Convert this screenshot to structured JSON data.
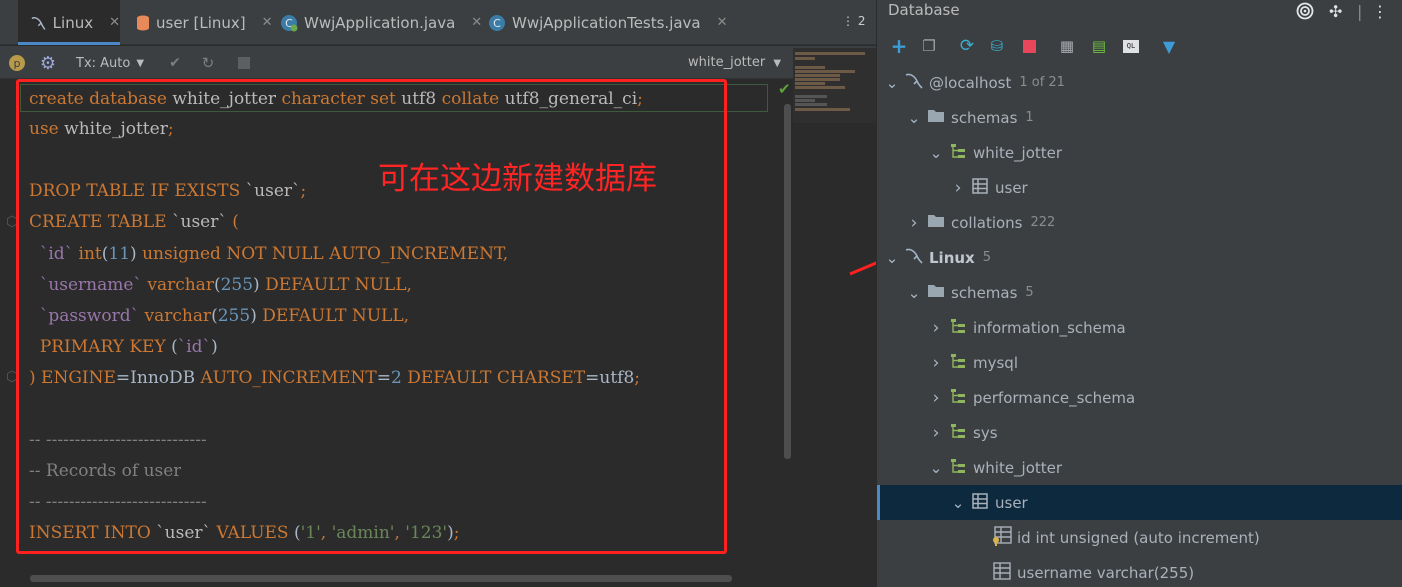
{
  "tabs": [
    {
      "label": "Linux",
      "icon": "mysql-dolphin-icon",
      "active": true
    },
    {
      "label": "user [Linux]",
      "icon": "table-icon",
      "active": false
    },
    {
      "label": "WwjApplication.java",
      "icon": "spring-class-icon",
      "active": false
    },
    {
      "label": "WwjApplicationTests.java",
      "icon": "class-icon",
      "active": false
    }
  ],
  "tab_overflow_count": "2",
  "toolbar": {
    "tx_mode": "Tx: Auto",
    "schema": "white_jotter"
  },
  "code_lines": [
    [
      [
        "kw",
        "create database "
      ],
      [
        "id",
        "white_jotter "
      ],
      [
        "kw",
        "character set "
      ],
      [
        "id",
        "utf8 "
      ],
      [
        "kw",
        "collate "
      ],
      [
        "id",
        "utf8_general_ci"
      ],
      [
        "kw",
        ";"
      ]
    ],
    [
      [
        "kw",
        "use "
      ],
      [
        "id",
        "white_jotter"
      ],
      [
        "kw",
        ";"
      ]
    ],
    [],
    [
      [
        "kw",
        "DROP TABLE IF EXISTS "
      ],
      [
        "id",
        "`user`"
      ],
      [
        "kw",
        ";"
      ]
    ],
    [
      [
        "kw",
        "CREATE TABLE "
      ],
      [
        "id",
        "`user` "
      ],
      [
        "kw",
        "("
      ]
    ],
    [
      [
        "pl",
        "  "
      ],
      [
        "bq",
        "`id` "
      ],
      [
        "kw",
        "int"
      ],
      [
        "pl",
        "("
      ],
      [
        "num",
        "11"
      ],
      [
        "pl",
        ") "
      ],
      [
        "kw",
        "unsigned NOT NULL AUTO_INCREMENT,"
      ]
    ],
    [
      [
        "pl",
        "  "
      ],
      [
        "bq",
        "`username` "
      ],
      [
        "kw",
        "varchar"
      ],
      [
        "pl",
        "("
      ],
      [
        "num",
        "255"
      ],
      [
        "pl",
        ") "
      ],
      [
        "kw",
        "DEFAULT NULL,"
      ]
    ],
    [
      [
        "pl",
        "  "
      ],
      [
        "bq",
        "`password` "
      ],
      [
        "kw",
        "varchar"
      ],
      [
        "pl",
        "("
      ],
      [
        "num",
        "255"
      ],
      [
        "pl",
        ") "
      ],
      [
        "kw",
        "DEFAULT NULL,"
      ]
    ],
    [
      [
        "pl",
        "  "
      ],
      [
        "kw",
        "PRIMARY KEY "
      ],
      [
        "pl",
        "("
      ],
      [
        "bq",
        "`id`"
      ],
      [
        "pl",
        ")"
      ]
    ],
    [
      [
        "kw",
        ") ENGINE"
      ],
      [
        "pl",
        "=InnoDB "
      ],
      [
        "kw",
        "AUTO_INCREMENT"
      ],
      [
        "pl",
        "="
      ],
      [
        "num",
        "2 "
      ],
      [
        "kw",
        "DEFAULT CHARSET"
      ],
      [
        "pl",
        "=utf8"
      ],
      [
        "kw",
        ";"
      ]
    ],
    [],
    [
      [
        "cm",
        "-- ----------------------------"
      ]
    ],
    [
      [
        "cm",
        "-- Records of user"
      ]
    ],
    [
      [
        "cm",
        "-- ----------------------------"
      ]
    ],
    [
      [
        "kw",
        "INSERT INTO "
      ],
      [
        "id",
        "`user` "
      ],
      [
        "kw",
        "VALUES "
      ],
      [
        "pl",
        "("
      ],
      [
        "str",
        "'1'"
      ],
      [
        "kw",
        ", "
      ],
      [
        "str",
        "'admin'"
      ],
      [
        "kw",
        ", "
      ],
      [
        "str",
        "'123'"
      ],
      [
        "pl",
        ")"
      ],
      [
        "kw",
        ";"
      ]
    ]
  ],
  "annotation": "可在这边新建数据库",
  "db_panel": {
    "title": "Database",
    "tree": [
      {
        "depth": 0,
        "chev": "down",
        "icon": "mysql-dolphin-icon",
        "label": "@localhost",
        "count": "1 of 21",
        "bold": false
      },
      {
        "depth": 1,
        "chev": "down",
        "icon": "folder-icon",
        "label": "schemas",
        "count": "1"
      },
      {
        "depth": 2,
        "chev": "down",
        "icon": "schema-icon",
        "label": "white_jotter",
        "count": ""
      },
      {
        "depth": 3,
        "chev": "right",
        "icon": "table-icon",
        "label": "user",
        "count": ""
      },
      {
        "depth": 1,
        "chev": "right",
        "icon": "folder-icon",
        "label": "collations",
        "count": "222"
      },
      {
        "depth": 0,
        "chev": "down",
        "icon": "mysql-dolphin-icon",
        "label": "Linux",
        "count": "5",
        "bold": true
      },
      {
        "depth": 1,
        "chev": "down",
        "icon": "folder-icon",
        "label": "schemas",
        "count": "5"
      },
      {
        "depth": 2,
        "chev": "right",
        "icon": "schema-icon",
        "label": "information_schema",
        "count": ""
      },
      {
        "depth": 2,
        "chev": "right",
        "icon": "schema-icon",
        "label": "mysql",
        "count": ""
      },
      {
        "depth": 2,
        "chev": "right",
        "icon": "schema-icon",
        "label": "performance_schema",
        "count": ""
      },
      {
        "depth": 2,
        "chev": "right",
        "icon": "schema-icon",
        "label": "sys",
        "count": ""
      },
      {
        "depth": 2,
        "chev": "down",
        "icon": "schema-icon",
        "label": "white_jotter",
        "count": ""
      },
      {
        "depth": 3,
        "chev": "down",
        "icon": "table-icon",
        "label": "user",
        "count": "",
        "selected": true
      },
      {
        "depth": 4,
        "chev": "",
        "icon": "key-column-icon",
        "label": "id int unsigned (auto increment)",
        "count": ""
      },
      {
        "depth": 4,
        "chev": "",
        "icon": "column-icon",
        "label": "username varchar(255)",
        "count": ""
      }
    ]
  }
}
